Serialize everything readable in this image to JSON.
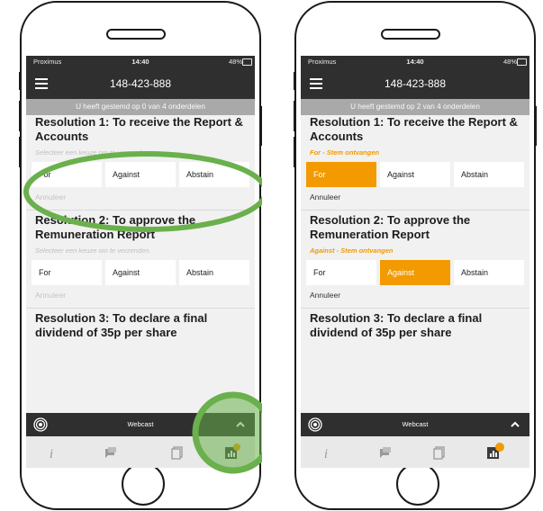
{
  "colors": {
    "accent": "#f29a00",
    "dark_bar": "#2f2f2f",
    "highlight_ring": "#6ab04c"
  },
  "left": {
    "status": {
      "carrier": "Proximus",
      "time": "14:40",
      "battery": "48%"
    },
    "header": {
      "title": "148-423-888"
    },
    "banner": "U heeft gestemd op 0 van 4 onderdelen",
    "res1": {
      "title": "Resolution 1: To receive the Report & Accounts",
      "hint": "Selecteer een keuze om te verzenden.",
      "for": "For",
      "against": "Against",
      "abstain": "Abstain",
      "cancel": "Annuleer"
    },
    "res2": {
      "title": "Resolution 2: To approve the Remuneration Report",
      "hint": "Selecteer een keuze om te verzenden.",
      "for": "For",
      "against": "Against",
      "abstain": "Abstain",
      "cancel": "Annuleer"
    },
    "res3": {
      "title": "Resolution 3: To declare a final dividend of 35p per share"
    },
    "webcast": "Webcast"
  },
  "right": {
    "status": {
      "carrier": "Proximus",
      "time": "14:40",
      "battery": "48%"
    },
    "header": {
      "title": "148-423-888"
    },
    "banner": "U heeft gestemd op 2 van 4 onderdelen",
    "res1": {
      "title": "Resolution 1: To receive the Report & Accounts",
      "hint": "For - Stem ontvangen",
      "for": "For",
      "against": "Against",
      "abstain": "Abstain",
      "cancel": "Annuleer",
      "selected": "for"
    },
    "res2": {
      "title": "Resolution 2: To approve the Remuneration Report",
      "hint": "Against - Stem ontvangen",
      "for": "For",
      "against": "Against",
      "abstain": "Abstain",
      "cancel": "Annuleer",
      "selected": "against"
    },
    "res3": {
      "title": "Resolution 3: To declare a final dividend of 35p per share"
    },
    "webcast": "Webcast"
  },
  "icons": {
    "radio": "broadcast-icon",
    "chevron": "chevron-up-icon",
    "info": "info-icon",
    "chat": "chat-icon",
    "documents": "documents-icon",
    "chart": "chart-icon"
  }
}
